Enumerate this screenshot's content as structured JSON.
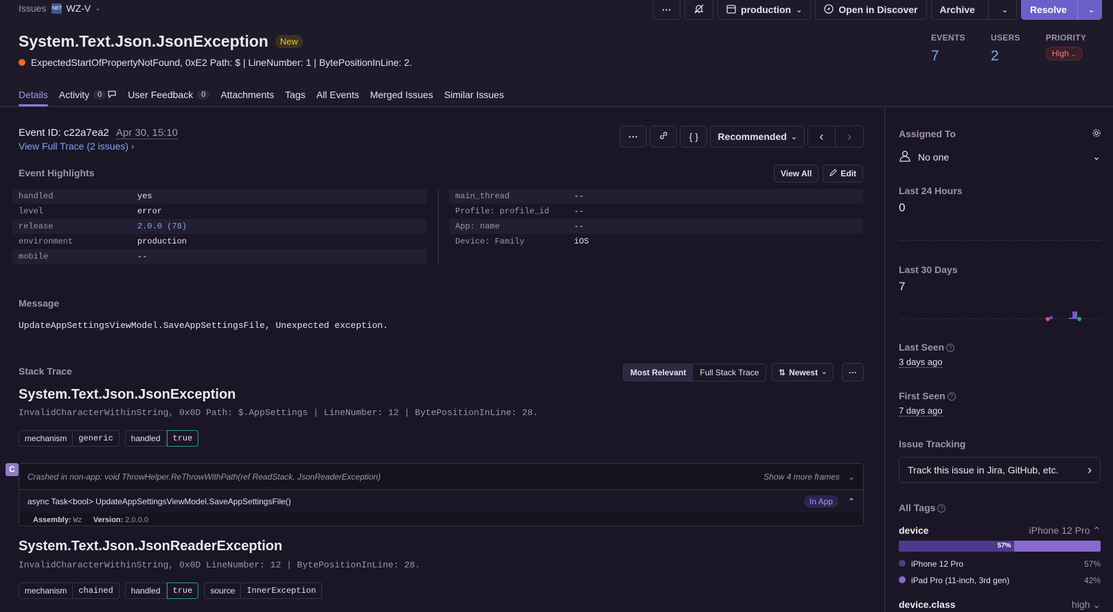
{
  "breadcrumb": {
    "root": "Issues",
    "project_badge": "NET",
    "project": "WZ-V"
  },
  "topbar": {
    "more": "···",
    "environment": "production",
    "open_discover": "Open in Discover",
    "archive": "Archive",
    "resolve": "Resolve"
  },
  "issue": {
    "title": "System.Text.Json.JsonException",
    "badge": "New",
    "subtitle": "ExpectedStartOfPropertyNotFound, 0xE2 Path: $ | LineNumber: 1 | BytePositionInLine: 2."
  },
  "stats": {
    "events_label": "EVENTS",
    "events": "7",
    "users_label": "USERS",
    "users": "2",
    "priority_label": "PRIORITY",
    "priority": "High"
  },
  "tabs": [
    {
      "label": "Details"
    },
    {
      "label": "Activity",
      "count": "0"
    },
    {
      "label": "User Feedback",
      "count": "0"
    },
    {
      "label": "Attachments"
    },
    {
      "label": "Tags"
    },
    {
      "label": "All Events"
    },
    {
      "label": "Merged Issues"
    },
    {
      "label": "Similar Issues"
    }
  ],
  "event": {
    "id_label": "Event ID:",
    "id": "c22a7ea2",
    "date": "Apr 30, 15:10",
    "trace_link": "View Full Trace (2 issues)",
    "recommended": "Recommended",
    "more": "···",
    "json": "{ }"
  },
  "highlights": {
    "heading": "Event Highlights",
    "view_all": "View All",
    "edit": "Edit",
    "left": [
      {
        "k": "handled",
        "v": "yes"
      },
      {
        "k": "level",
        "v": "error"
      },
      {
        "k": "release",
        "v": "2.0.0 (78)"
      },
      {
        "k": "environment",
        "v": "production"
      },
      {
        "k": "mobile",
        "v": "--"
      }
    ],
    "right": [
      {
        "k": "main_thread",
        "v": "--"
      },
      {
        "k": "Profile: profile_id",
        "v": "--"
      },
      {
        "k": "App: name",
        "v": "--"
      },
      {
        "k": "Device: Family",
        "v": "iOS"
      }
    ]
  },
  "message": {
    "heading": "Message",
    "text": "UpdateAppSettingsViewModel.SaveAppSettingsFile, Unexpected exception."
  },
  "stacktrace": {
    "heading": "Stack Trace",
    "most_relevant": "Most Relevant",
    "full": "Full Stack Trace",
    "sort": "Newest",
    "more": "···",
    "ex1": {
      "title": "System.Text.Json.JsonException",
      "sub": "InvalidCharacterWithinString, 0x0D Path: $.AppSettings | LineNumber: 12 | BytePositionInLine: 28.",
      "tags": [
        {
          "k": "mechanism",
          "v": "generic"
        },
        {
          "k": "handled",
          "v": "true"
        }
      ]
    },
    "frames": {
      "icon": "C",
      "crashed": "Crashed in non-app: void ThrowHelper.ReThrowWithPath(ref ReadStack, JsonReaderException)",
      "show_more": "Show 4 more frames",
      "frame": "async Task<bool> UpdateAppSettingsViewModel.SaveAppSettingsFile()",
      "in_app": "In App",
      "assembly_label": "Assembly:",
      "assembly": "Wz",
      "version_label": "Version:",
      "version": "2.0.0.0"
    },
    "ex2": {
      "title": "System.Text.Json.JsonReaderException",
      "sub": "InvalidCharacterWithinString, 0x0D LineNumber: 12 | BytePositionInLine: 28.",
      "tags": [
        {
          "k": "mechanism",
          "v": "chained"
        },
        {
          "k": "handled",
          "v": "true"
        },
        {
          "k": "source",
          "v": "InnerException"
        }
      ]
    }
  },
  "sidebar": {
    "assigned_to": "Assigned To",
    "no_one": "No one",
    "last24_label": "Last 24 Hours",
    "last24": "0",
    "last30_label": "Last 30 Days",
    "last30": "7",
    "last_seen_label": "Last Seen",
    "last_seen": "3 days ago",
    "first_seen_label": "First Seen",
    "first_seen": "7 days ago",
    "tracking_label": "Issue Tracking",
    "tracking": "Track this issue in Jira, GitHub, etc.",
    "all_tags": "All Tags",
    "device_tag": "device",
    "device_top": "iPhone 12 Pro",
    "device_bar_pct": 57,
    "device_bar_label": "57%",
    "device_values": [
      {
        "name": "iPhone 12 Pro",
        "pct": "57%",
        "color": "#4e3a8c"
      },
      {
        "name": "iPad Pro (11-inch, 3rd gen)",
        "pct": "42%",
        "color": "#8a69cf"
      }
    ],
    "device_class_tag": "device.class",
    "device_class_top": "high"
  },
  "colors": {
    "accent": "#6c5fc7",
    "link": "#7fa6f8",
    "new_badge": "#f1c232",
    "error_dot": "#f2672b"
  }
}
